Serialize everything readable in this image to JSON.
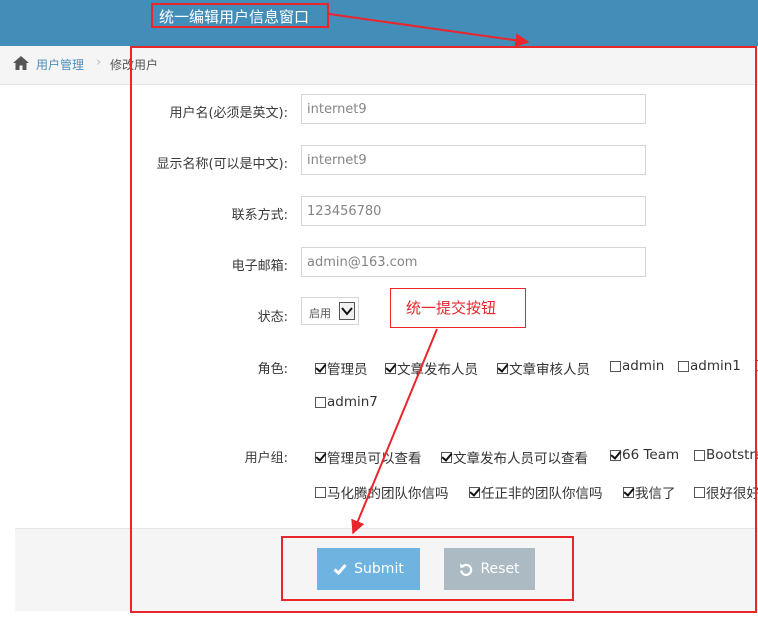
{
  "annotations": {
    "window_note": "统一编辑用户信息窗口",
    "submit_note": "统一提交按钮"
  },
  "breadcrumb": {
    "parent": "用户管理",
    "current": "修改用户"
  },
  "form": {
    "username": {
      "label": "用户名(必须是英文):",
      "value": "internet9"
    },
    "display_name": {
      "label": "显示名称(可以是中文):",
      "value": "internet9"
    },
    "contact": {
      "label": "联系方式:",
      "value": "123456780"
    },
    "email": {
      "label": "电子邮箱:",
      "value": "admin@163.com"
    },
    "status": {
      "label": "状态:",
      "selected": "启用"
    },
    "roles": {
      "label": "角色:",
      "items": [
        {
          "label": "管理员",
          "checked": true
        },
        {
          "label": "文章发布人员",
          "checked": true
        },
        {
          "label": "文章审核人员",
          "checked": true
        },
        {
          "label": "admin",
          "checked": false
        },
        {
          "label": "admin1",
          "checked": false
        },
        {
          "label": "admin7",
          "checked": false
        }
      ]
    },
    "groups": {
      "label": "用户组:",
      "items": [
        {
          "label": "管理员可以查看",
          "checked": true
        },
        {
          "label": "文章发布人员可以查看",
          "checked": true
        },
        {
          "label": "66 Team",
          "checked": true
        },
        {
          "label": "Bootstra",
          "checked": false
        },
        {
          "label": "马化腾的团队你信吗",
          "checked": false
        },
        {
          "label": "任正非的团队你信吗",
          "checked": true
        },
        {
          "label": "我信了",
          "checked": true
        },
        {
          "label": "很好很好",
          "checked": false
        }
      ]
    }
  },
  "buttons": {
    "submit": "Submit",
    "reset": "Reset"
  },
  "colors": {
    "header": "#438eb9",
    "annotation": "#e8262b",
    "submit": "#6fb3e0",
    "reset": "#abbac3"
  }
}
